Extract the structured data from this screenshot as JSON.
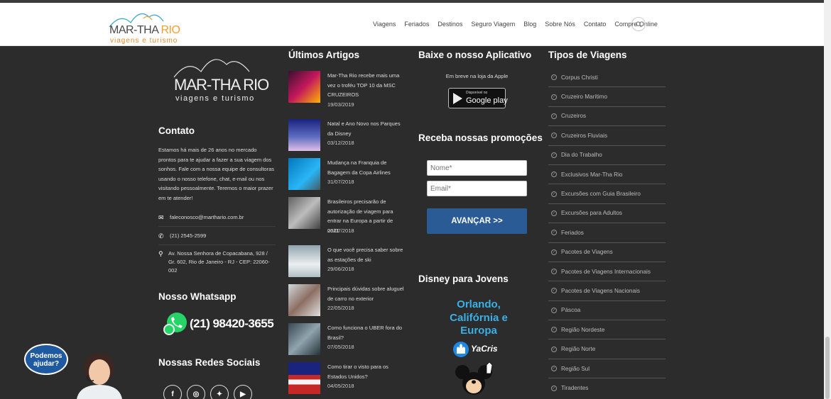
{
  "header": {
    "logo_brand_a": "MAR-THA",
    "logo_brand_b": "RIO",
    "logo_tagline": "viagens e turismo",
    "nav": [
      "Viagens",
      "Feriados",
      "Destinos",
      "Seguro Viagem",
      "Blog",
      "Sobre Nós",
      "Contato",
      "Compre Online"
    ],
    "search_icon": "search-icon"
  },
  "col1": {
    "logo_brand": "MAR-THA RIO",
    "logo_tagline": "viagens e turismo",
    "contact_title": "Contato",
    "contact_text": "Estamos há mais de 26 anos no mercado prontos para te ajudar a fazer a sua viagem dos sonhos. Fale com a nossa equipe de consultoras usando o nosso telefone, chat, e-mail ou nos visitando pessoalmente. Teremos o maior prazer em te atender!",
    "email": "faleconosco@marthario.com.br",
    "phone": "(21) 2545-2599",
    "address": "Av. Nossa Senhora de Copacabana, 928 / Gr. 602, Rio de Janeiro - RJ - CEP: 22060-002",
    "whatsapp_title": "Nosso Whatsapp",
    "whatsapp_number": "(21) 98420-3655",
    "social_title": "Nossas Redes Sociais"
  },
  "col2": {
    "title": "Últimos Artigos",
    "articles": [
      {
        "title": "Mar-Tha Rio recebe mais uma vez o troféu TOP 10 da MSC CRUZEIROS",
        "date": "19/03/2019"
      },
      {
        "title": "Natal e Ano Novo nos Parques da Disney",
        "date": "03/12/2018"
      },
      {
        "title": "Mudança na Franquia de Bagagem da Copa Airlines",
        "date": "31/07/2018"
      },
      {
        "title": "Brasileiros precisarão de autorização de viagem para entrar na Europa a partir de 2021",
        "date": "06/07/2018"
      },
      {
        "title": "O que você precisa saber sobre as estações de ski",
        "date": "29/06/2018"
      },
      {
        "title": "Principais dúvidas sobre aluguel de carro no exterior",
        "date": "22/05/2018"
      },
      {
        "title": "Como funciona o UBER fora do Brasil?",
        "date": "07/05/2018"
      },
      {
        "title": "Como tirar o visto para os Estados Unidos?",
        "date": "04/05/2018"
      }
    ]
  },
  "col3": {
    "app_title": "Baixe o nosso Aplicativo",
    "app_text": "Em breve na loja da Apple",
    "gplay_small": "Disponível no",
    "gplay_big": "Google play",
    "promo_title": "Receba nossas promoções",
    "name_placeholder": "Nome*",
    "email_placeholder": "Email*",
    "submit_label": "AVANÇAR >>",
    "disney_title": "Disney para Jovens",
    "disney_l1": "Orlando,",
    "disney_l2": "Califórnia e",
    "disney_l3": "Europa",
    "disney_logo": "YaCris"
  },
  "col4": {
    "title": "Tipos de Viagens",
    "types": [
      "Corpus Christi",
      "Cruzeiro Marítimo",
      "Cruzeiros",
      "Cruzeiros Fluviais",
      "Dia do Trabalho",
      "Exclusivos Mar-Tha Rio",
      "Excursões com Guia Brasileiro",
      "Excursões para Adultos",
      "Feriados",
      "Pacotes de Viagens",
      "Pacotes de Viagens Internacionais",
      "Pacotes de Viagens Nacionais",
      "Páscoa",
      "Região Nordeste",
      "Região Norte",
      "Região Sul",
      "Tiradentes"
    ]
  },
  "chat": {
    "bubble_text": "Podemos ajudar?"
  },
  "colors": {
    "accent": "#2a5b94",
    "bg": "#2c2c2c",
    "whatsapp": "#25d366"
  }
}
